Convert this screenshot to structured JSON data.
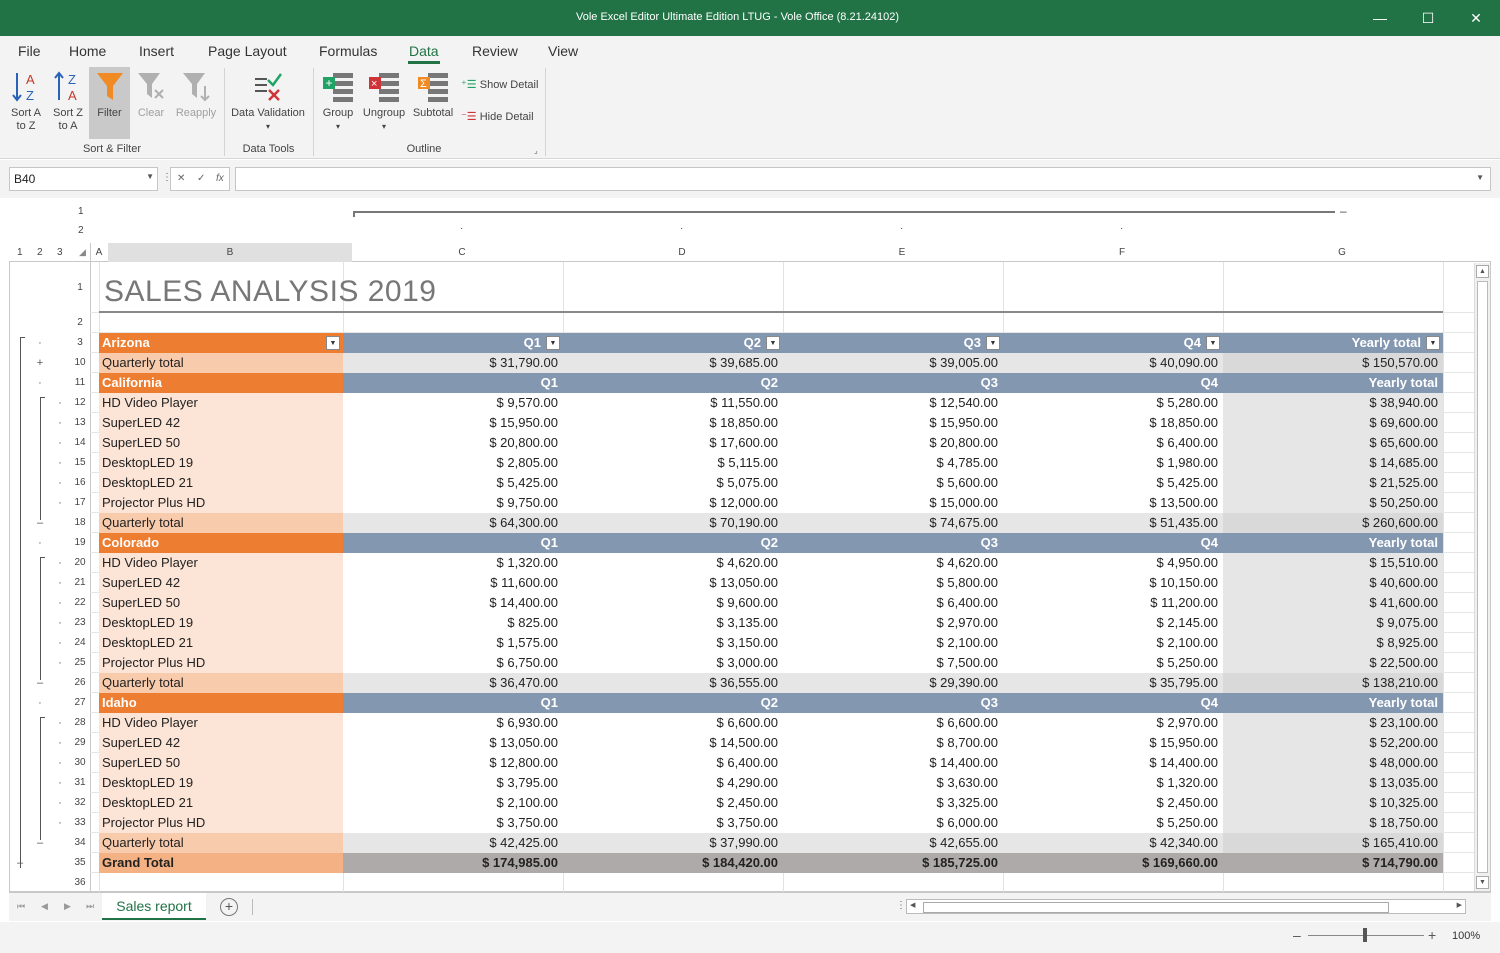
{
  "window": {
    "title": "Vole Excel Editor Ultimate Edition LTUG - Vole Office (8.21.24102)",
    "min_glyph": "—",
    "max_glyph": "☐",
    "close_glyph": "✕"
  },
  "menu": {
    "tabs": [
      "File",
      "Home",
      "Insert",
      "Page Layout",
      "Formulas",
      "Data",
      "Review",
      "View"
    ],
    "active": "Data"
  },
  "ribbon": {
    "sort_az": "Sort A to Z",
    "sort_az_l1": "Sort A",
    "sort_az_l2": "to Z",
    "sort_za_l1": "Sort Z",
    "sort_za_l2": "to A",
    "filter": "Filter",
    "clear": "Clear",
    "reapply": "Reapply",
    "data_validation": "Data Validation",
    "group": "Group",
    "ungroup": "Ungroup",
    "subtotal": "Subtotal",
    "show_detail": "Show Detail",
    "hide_detail": "Hide Detail",
    "group_sort_filter": "Sort & Filter",
    "group_data_tools": "Data Tools",
    "group_outline": "Outline"
  },
  "formula_bar": {
    "name_box": "B40",
    "formula": ""
  },
  "outline": {
    "row_levels": [
      "1",
      "2",
      "3"
    ],
    "col_levels": [
      "1",
      "2"
    ],
    "col_collapse": "–"
  },
  "columns": [
    "A",
    "B",
    "C",
    "D",
    "E",
    "F",
    "G"
  ],
  "sheet": {
    "title": "SALES ANALYSIS 2019",
    "rows": [
      {
        "num": "1",
        "kind": "title"
      },
      {
        "num": "2",
        "kind": "blank"
      },
      {
        "num": "3",
        "kind": "header",
        "region": "Arizona",
        "cols": [
          "Q1",
          "Q2",
          "Q3",
          "Q4",
          "Yearly total"
        ],
        "filters": true,
        "sym": "·"
      },
      {
        "num": "10",
        "kind": "qtotal",
        "label": "Quarterly total",
        "vals": [
          "$ 31,790.00",
          "$ 39,685.00",
          "$ 39,005.00",
          "$ 40,090.00",
          "$ 150,570.00"
        ],
        "sym": "+"
      },
      {
        "num": "11",
        "kind": "header",
        "region": "California",
        "cols": [
          "Q1",
          "Q2",
          "Q3",
          "Q4",
          "Yearly total"
        ],
        "sym": "·"
      },
      {
        "num": "12",
        "kind": "item",
        "label": "HD Video Player",
        "vals": [
          "$ 9,570.00",
          "$ 11,550.00",
          "$ 12,540.00",
          "$ 5,280.00",
          "$ 38,940.00"
        ],
        "sym": "·"
      },
      {
        "num": "13",
        "kind": "item",
        "label": "SuperLED 42",
        "vals": [
          "$ 15,950.00",
          "$ 18,850.00",
          "$ 15,950.00",
          "$ 18,850.00",
          "$ 69,600.00"
        ],
        "sym": "·"
      },
      {
        "num": "14",
        "kind": "item",
        "label": "SuperLED 50",
        "vals": [
          "$ 20,800.00",
          "$ 17,600.00",
          "$ 20,800.00",
          "$ 6,400.00",
          "$ 65,600.00"
        ],
        "sym": "·"
      },
      {
        "num": "15",
        "kind": "item",
        "label": "DesktopLED 19",
        "vals": [
          "$ 2,805.00",
          "$ 5,115.00",
          "$ 4,785.00",
          "$ 1,980.00",
          "$ 14,685.00"
        ],
        "sym": "·"
      },
      {
        "num": "16",
        "kind": "item",
        "label": "DesktopLED 21",
        "vals": [
          "$ 5,425.00",
          "$ 5,075.00",
          "$ 5,600.00",
          "$ 5,425.00",
          "$ 21,525.00"
        ],
        "sym": "·"
      },
      {
        "num": "17",
        "kind": "item",
        "label": "Projector Plus HD",
        "vals": [
          "$ 9,750.00",
          "$ 12,000.00",
          "$ 15,000.00",
          "$ 13,500.00",
          "$ 50,250.00"
        ],
        "sym": "·"
      },
      {
        "num": "18",
        "kind": "qtotal",
        "label": "Quarterly total",
        "vals": [
          "$ 64,300.00",
          "$ 70,190.00",
          "$ 74,675.00",
          "$ 51,435.00",
          "$ 260,600.00"
        ],
        "sym": "–"
      },
      {
        "num": "19",
        "kind": "header",
        "region": "Colorado",
        "cols": [
          "Q1",
          "Q2",
          "Q3",
          "Q4",
          "Yearly total"
        ],
        "sym": "·"
      },
      {
        "num": "20",
        "kind": "item",
        "label": "HD Video Player",
        "vals": [
          "$ 1,320.00",
          "$ 4,620.00",
          "$ 4,620.00",
          "$ 4,950.00",
          "$ 15,510.00"
        ],
        "sym": "·"
      },
      {
        "num": "21",
        "kind": "item",
        "label": "SuperLED 42",
        "vals": [
          "$ 11,600.00",
          "$ 13,050.00",
          "$ 5,800.00",
          "$ 10,150.00",
          "$ 40,600.00"
        ],
        "sym": "·"
      },
      {
        "num": "22",
        "kind": "item",
        "label": "SuperLED 50",
        "vals": [
          "$ 14,400.00",
          "$ 9,600.00",
          "$ 6,400.00",
          "$ 11,200.00",
          "$ 41,600.00"
        ],
        "sym": "·"
      },
      {
        "num": "23",
        "kind": "item",
        "label": "DesktopLED 19",
        "vals": [
          "$ 825.00",
          "$ 3,135.00",
          "$ 2,970.00",
          "$ 2,145.00",
          "$ 9,075.00"
        ],
        "sym": "·"
      },
      {
        "num": "24",
        "kind": "item",
        "label": "DesktopLED 21",
        "vals": [
          "$ 1,575.00",
          "$ 3,150.00",
          "$ 2,100.00",
          "$ 2,100.00",
          "$ 8,925.00"
        ],
        "sym": "·"
      },
      {
        "num": "25",
        "kind": "item",
        "label": "Projector Plus HD",
        "vals": [
          "$ 6,750.00",
          "$ 3,000.00",
          "$ 7,500.00",
          "$ 5,250.00",
          "$ 22,500.00"
        ],
        "sym": "·"
      },
      {
        "num": "26",
        "kind": "qtotal",
        "label": "Quarterly total",
        "vals": [
          "$ 36,470.00",
          "$ 36,555.00",
          "$ 29,390.00",
          "$ 35,795.00",
          "$ 138,210.00"
        ],
        "sym": "–"
      },
      {
        "num": "27",
        "kind": "header",
        "region": "Idaho",
        "cols": [
          "Q1",
          "Q2",
          "Q3",
          "Q4",
          "Yearly total"
        ],
        "sym": "·"
      },
      {
        "num": "28",
        "kind": "item",
        "label": "HD Video Player",
        "vals": [
          "$ 6,930.00",
          "$ 6,600.00",
          "$ 6,600.00",
          "$ 2,970.00",
          "$ 23,100.00"
        ],
        "sym": "·"
      },
      {
        "num": "29",
        "kind": "item",
        "label": "SuperLED 42",
        "vals": [
          "$ 13,050.00",
          "$ 14,500.00",
          "$ 8,700.00",
          "$ 15,950.00",
          "$ 52,200.00"
        ],
        "sym": "·"
      },
      {
        "num": "30",
        "kind": "item",
        "label": "SuperLED 50",
        "vals": [
          "$ 12,800.00",
          "$ 6,400.00",
          "$ 14,400.00",
          "$ 14,400.00",
          "$ 48,000.00"
        ],
        "sym": "·"
      },
      {
        "num": "31",
        "kind": "item",
        "label": "DesktopLED 19",
        "vals": [
          "$ 3,795.00",
          "$ 4,290.00",
          "$ 3,630.00",
          "$ 1,320.00",
          "$ 13,035.00"
        ],
        "sym": "·"
      },
      {
        "num": "32",
        "kind": "item",
        "label": "DesktopLED 21",
        "vals": [
          "$ 2,100.00",
          "$ 2,450.00",
          "$ 3,325.00",
          "$ 2,450.00",
          "$ 10,325.00"
        ],
        "sym": "·"
      },
      {
        "num": "33",
        "kind": "item",
        "label": "Projector Plus HD",
        "vals": [
          "$ 3,750.00",
          "$ 3,750.00",
          "$ 6,000.00",
          "$ 5,250.00",
          "$ 18,750.00"
        ],
        "sym": "·"
      },
      {
        "num": "34",
        "kind": "qtotal",
        "label": "Quarterly total",
        "vals": [
          "$ 42,425.00",
          "$ 37,990.00",
          "$ 42,655.00",
          "$ 42,340.00",
          "$ 165,410.00"
        ],
        "sym": "–"
      },
      {
        "num": "35",
        "kind": "grand",
        "label": "Grand Total",
        "vals": [
          "$ 174,985.00",
          "$ 184,420.00",
          "$ 185,725.00",
          "$ 169,660.00",
          "$ 714,790.00"
        ],
        "sym": "–"
      },
      {
        "num": "36",
        "kind": "blank"
      }
    ]
  },
  "colors": {
    "accent": "#217346",
    "region_header": "#ED7D31",
    "quarter_header": "#8497B0",
    "label_column": "#FCE4D6",
    "qtotal_label": "#F8CBAD",
    "qtotal_cells": "#E7E6E6",
    "yearly_column": "#E7E6E6",
    "grand_label": "#F4B183",
    "grand_cells": "#AEAAAA"
  },
  "sheet_tabs": {
    "active": "Sales report",
    "add_glyph": "+"
  },
  "status": {
    "zoom": "100%",
    "zoom_minus": "–",
    "zoom_plus": "+"
  }
}
